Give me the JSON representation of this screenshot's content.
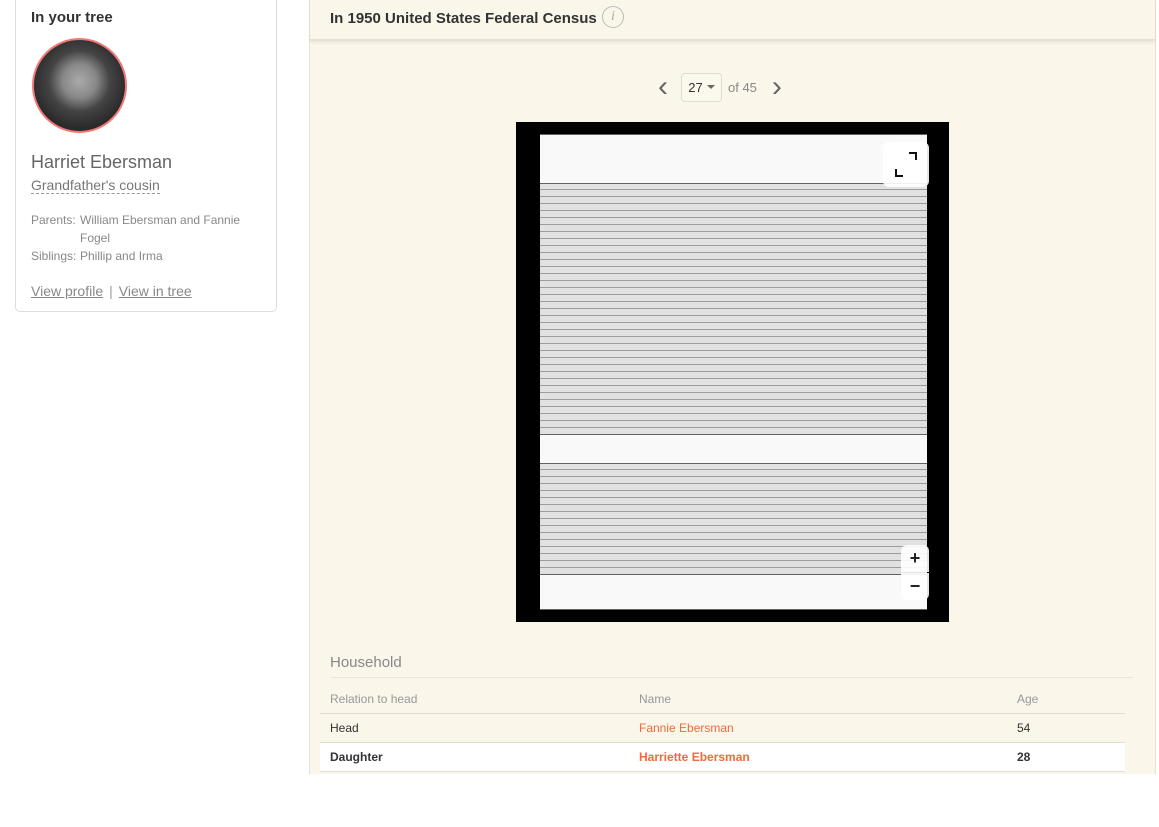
{
  "tree_card": {
    "title": "In your tree",
    "name": "Harriet Ebersman",
    "relationship": "Grandfather's cousin",
    "facts": [
      {
        "label": "Parents:",
        "value": "William Ebersman and Fannie Fogel"
      },
      {
        "label": "Siblings:",
        "value": "Phillip and Irma"
      }
    ],
    "view_profile": "View profile",
    "separator": "|",
    "view_in_tree": "View in tree"
  },
  "record": {
    "title": "In 1950 United States Federal Census",
    "info_icon": "i",
    "pager": {
      "current": "27",
      "of_label": "of 45"
    },
    "zoom_in": "+",
    "zoom_out": "−",
    "household": {
      "title": "Household",
      "columns": [
        "Relation to head",
        "Name",
        "Age"
      ],
      "rows": [
        {
          "relation": "Head",
          "name": "Fannie Ebersman",
          "age": "54"
        },
        {
          "relation": "Daughter",
          "name": "Harriette Ebersman",
          "age": "28",
          "highlighted": true
        }
      ]
    }
  },
  "colors": {
    "accent": "#f06a3a",
    "panel_bg": "#faf6ea",
    "avatar_ring": "#f07878"
  }
}
